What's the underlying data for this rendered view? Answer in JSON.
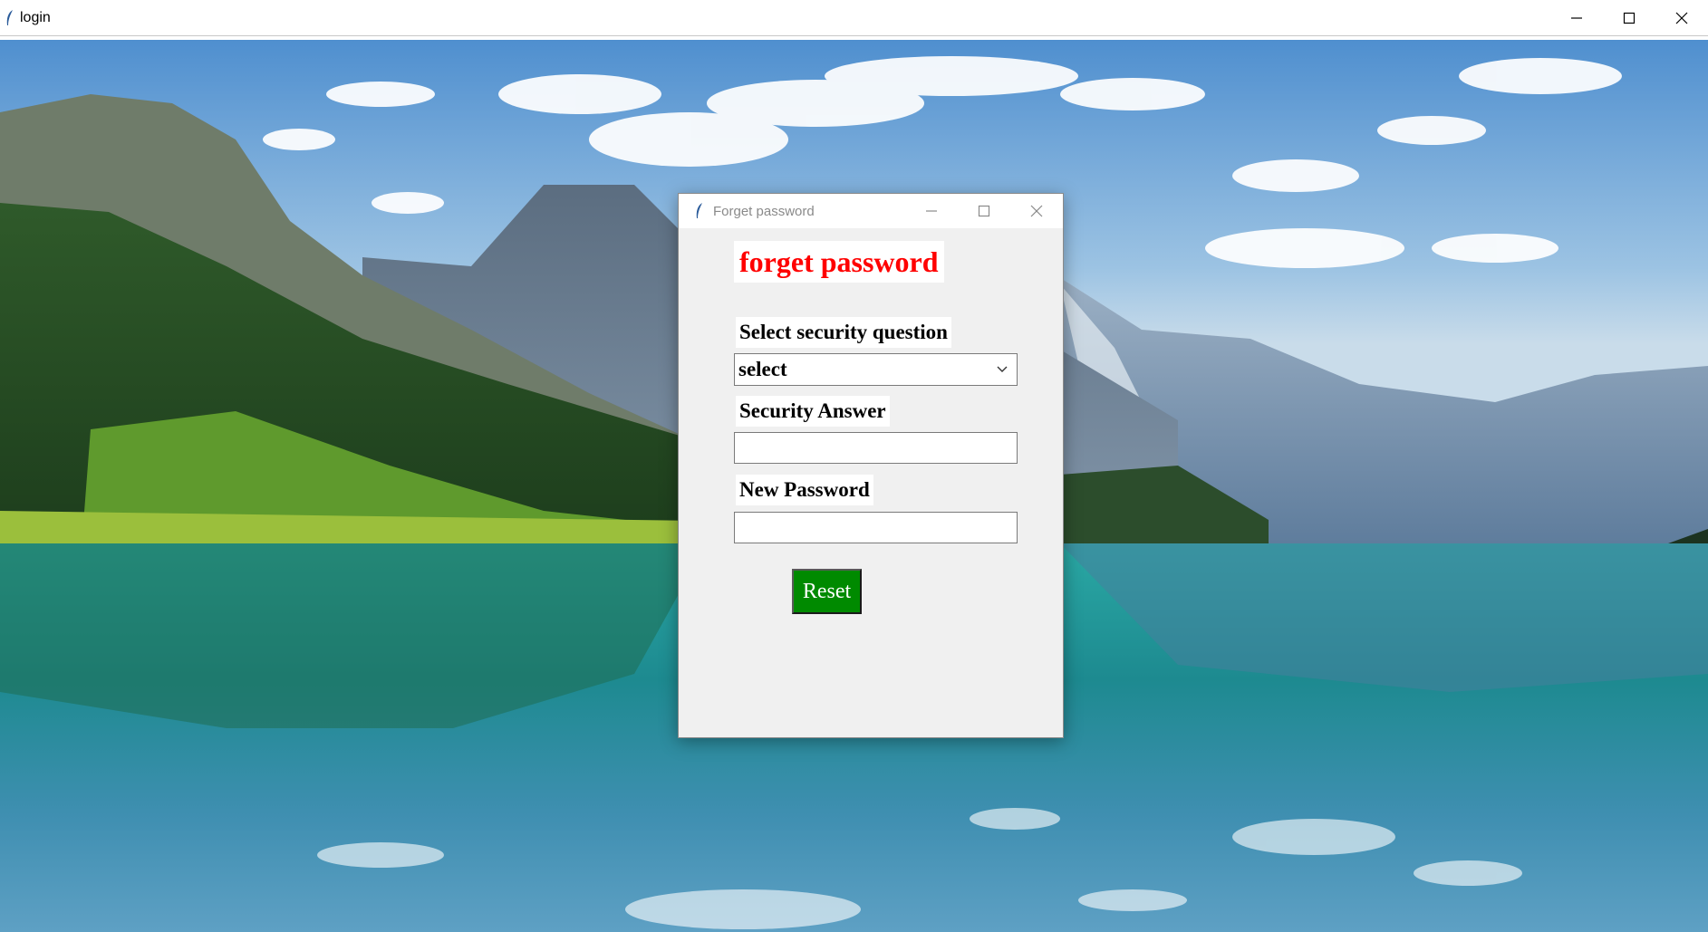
{
  "main_window": {
    "title": "login",
    "controls": [
      "minimize-icon",
      "maximize-icon",
      "close-icon"
    ]
  },
  "dialog": {
    "title": "Forget password",
    "controls": [
      "minimize-icon",
      "maximize-icon",
      "close-icon"
    ],
    "heading": "forget password",
    "security_question": {
      "label": "Select security question",
      "selected": "select"
    },
    "security_answer": {
      "label": "Security Answer",
      "value": ""
    },
    "new_password": {
      "label": "New Password",
      "value": ""
    },
    "reset_label": "Reset"
  },
  "colors": {
    "heading": "#ff0000",
    "reset_button": "#008a00",
    "dialog_bg": "#f0f0f0"
  }
}
